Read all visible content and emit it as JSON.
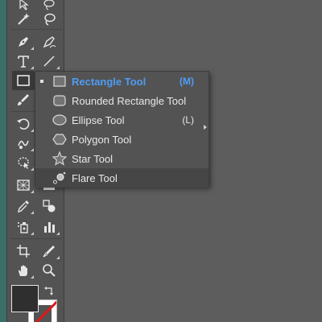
{
  "flyout": {
    "items": [
      {
        "label": "Rectangle Tool",
        "shortcut": "(M)",
        "icon": "rectangle-icon",
        "active": true
      },
      {
        "label": "Rounded Rectangle Tool",
        "shortcut": "",
        "icon": "rounded-rectangle-icon"
      },
      {
        "label": "Ellipse Tool",
        "shortcut": "(L)",
        "icon": "ellipse-icon"
      },
      {
        "label": "Polygon Tool",
        "shortcut": "",
        "icon": "polygon-icon"
      },
      {
        "label": "Star Tool",
        "shortcut": "",
        "icon": "star-icon"
      },
      {
        "label": "Flare Tool",
        "shortcut": "",
        "icon": "flare-icon",
        "hover": true
      }
    ]
  },
  "toolbar": {
    "tools": [
      "direct-selection-icon",
      "lasso-icon",
      "magic-wand-icon",
      "pen-icon",
      "curvature-icon",
      "type-icon",
      "line-segment-icon",
      "rectangle-icon",
      "paintbrush-icon",
      "rotate-icon",
      "warp-icon",
      "free-transform-icon",
      "perspective-grid-icon",
      "eyedropper-icon",
      "blend-icon",
      "symbol-sprayer-icon",
      "column-graph-icon",
      "artboard-icon",
      "slice-icon",
      "hand-icon",
      "zoom-icon"
    ],
    "selected_tool": "rectangle-icon"
  },
  "colors": {
    "accent": "#4f9cf4",
    "fill": "#2f2f2f",
    "stroke": "none"
  }
}
